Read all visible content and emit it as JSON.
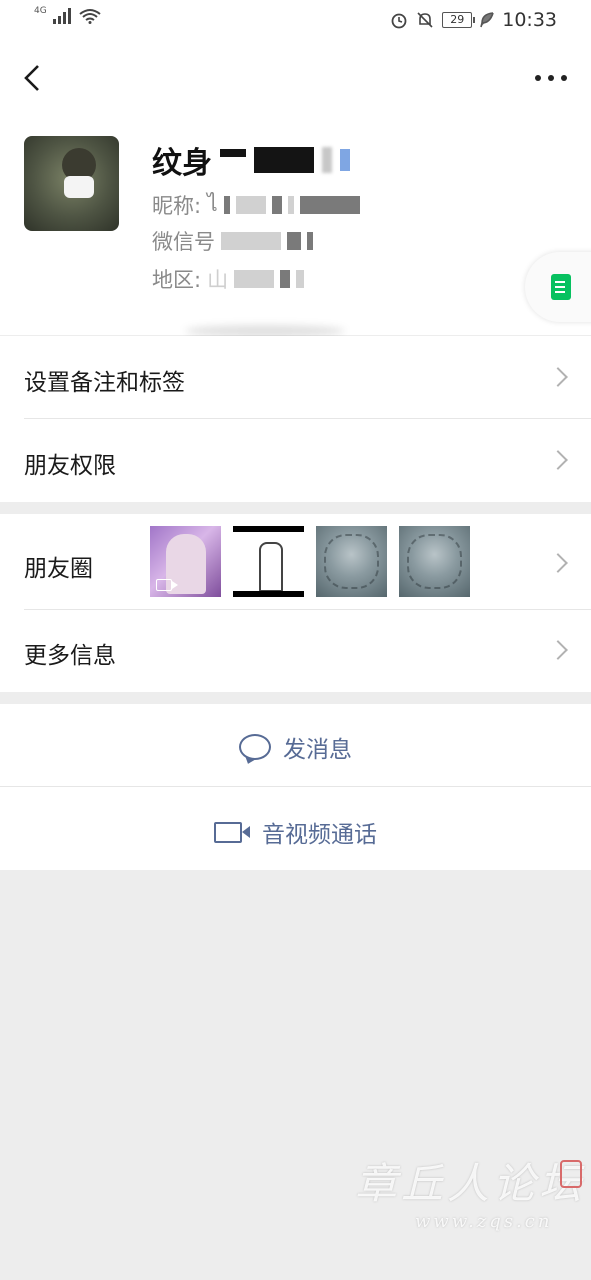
{
  "status_bar": {
    "network": "4G",
    "battery": "29",
    "time": "10:33"
  },
  "profile": {
    "name": "纹身",
    "nickname_label": "昵称:",
    "nickname_partial": "ไ",
    "wechat_id_label": "微信号",
    "region_label": "地区:",
    "region_partial": "山"
  },
  "menu": {
    "remark_tags": "设置备注和标签",
    "friend_permissions": "朋友权限",
    "moments": "朋友圈",
    "more_info": "更多信息"
  },
  "actions": {
    "send_message": "发消息",
    "av_call": "音视频通话"
  },
  "watermark": {
    "cn": "章丘人论坛",
    "en": "www.zqs.cn"
  },
  "colors": {
    "link": "#576b95",
    "background": "#ededed",
    "accent_green": "#07c160"
  }
}
